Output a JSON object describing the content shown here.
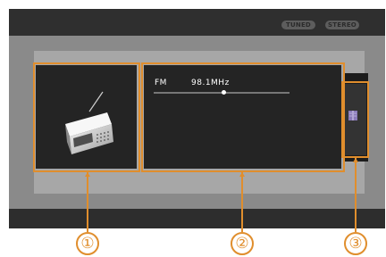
{
  "status": {
    "tuned_label": "TUNED",
    "stereo_label": "STEREO"
  },
  "tuner": {
    "band": "FM",
    "frequency": "98.1MHz",
    "seek_position": 0.5
  },
  "icons": {
    "source": "radio-icon",
    "side": "book-icon"
  },
  "callouts": [
    "①",
    "②",
    "③"
  ],
  "colors": {
    "highlight": "#e08e2d",
    "screen_bg": "#343434",
    "panel_bg": "#242424"
  }
}
